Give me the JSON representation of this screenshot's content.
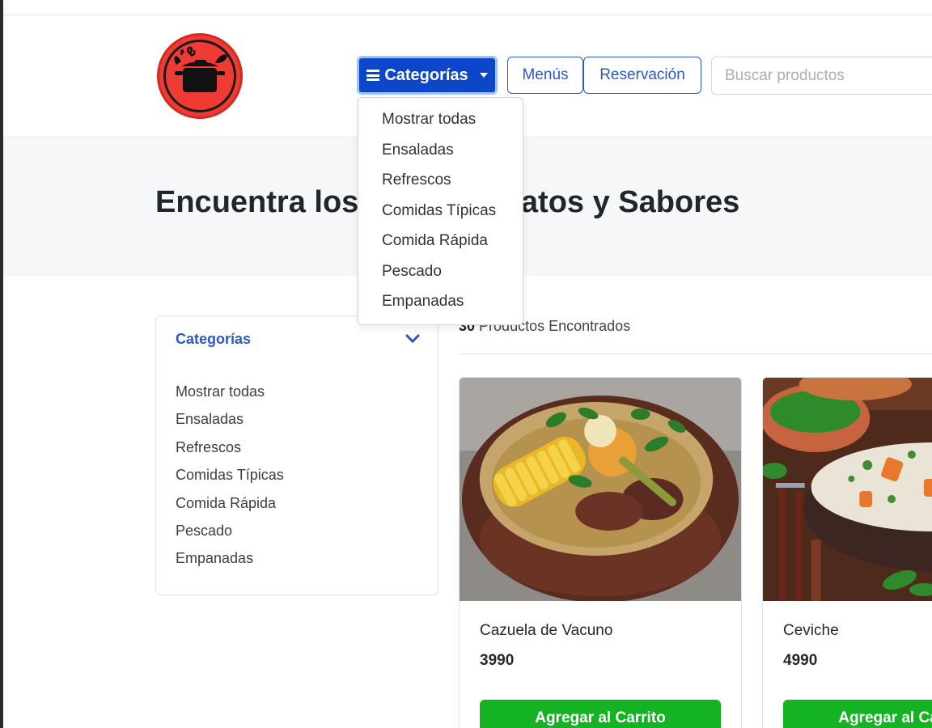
{
  "header": {
    "categories_button": "Categorías",
    "menus_button": "Menús",
    "reservation_button": "Reservación",
    "search_placeholder": "Buscar productos"
  },
  "dropdown": {
    "items": [
      "Mostrar todas",
      "Ensaladas",
      "Refrescos",
      "Comidas Típicas",
      "Comida Rápida",
      "Pescado",
      "Empanadas"
    ]
  },
  "hero": {
    "title": "Encuentra los Mejores Platos y Sabores"
  },
  "sidebar": {
    "title": "Categorías",
    "items": [
      "Mostrar todas",
      "Ensaladas",
      "Refrescos",
      "Comidas Típicas",
      "Comida Rápida",
      "Pescado",
      "Empanadas"
    ]
  },
  "results": {
    "count": "30",
    "label": "Productos Encontrados"
  },
  "products": [
    {
      "name": "Cazuela de Vacuno",
      "price": "3990",
      "button": "Agregar al Carrito"
    },
    {
      "name": "Ceviche",
      "price": "4990",
      "button": "Agregar al Carrito"
    }
  ],
  "colors": {
    "primary": "#0d47c9",
    "outline": "#2a58c4",
    "success": "#14b324",
    "logo": "#ef3b33"
  }
}
